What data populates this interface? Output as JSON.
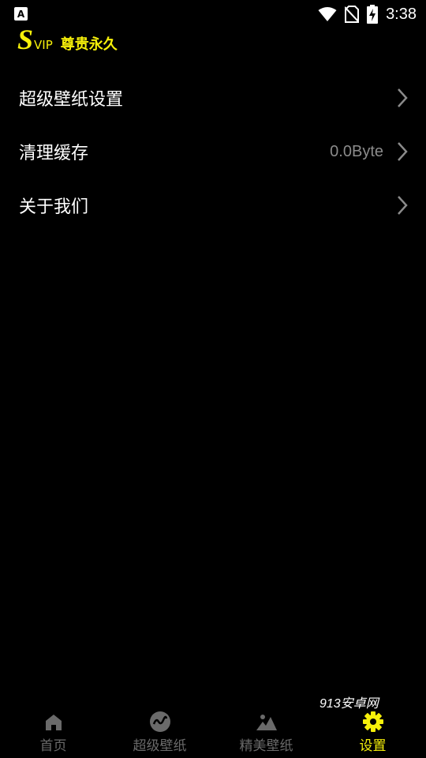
{
  "status_bar": {
    "notification_icon": "A",
    "time": "3:38",
    "icons": [
      "wifi-icon",
      "no-sim-icon",
      "battery-charging-icon"
    ]
  },
  "vip": {
    "badge_s": "S",
    "badge_vip": "VIP",
    "text": "尊贵永久",
    "accent_color": "#f6f00a"
  },
  "menu": [
    {
      "label": "超级壁纸设置",
      "value": ""
    },
    {
      "label": "清理缓存",
      "value": "0.0Byte"
    },
    {
      "label": "关于我们",
      "value": ""
    }
  ],
  "watermark": "913安卓网",
  "tabs": [
    {
      "label": "首页",
      "icon": "home-icon",
      "active": false
    },
    {
      "label": "超级壁纸",
      "icon": "wave-icon",
      "active": false
    },
    {
      "label": "精美壁纸",
      "icon": "landscape-icon",
      "active": false
    },
    {
      "label": "设置",
      "icon": "gear-icon",
      "active": true
    }
  ]
}
